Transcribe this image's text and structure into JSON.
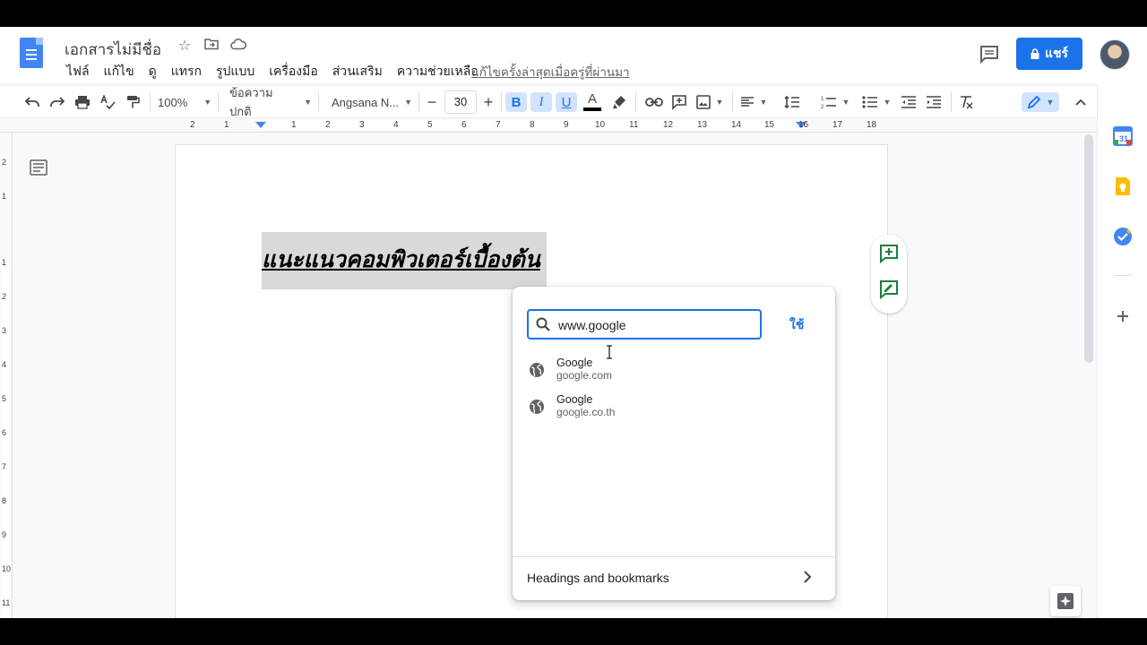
{
  "header": {
    "doc_title": "เอกสารไม่มีชื่อ",
    "menu": [
      "ไฟล์",
      "แก้ไข",
      "ดู",
      "แทรก",
      "รูปแบบ",
      "เครื่องมือ",
      "ส่วนเสริม",
      "ความช่วยเหลือ"
    ],
    "last_edit": "แก้ไขครั้งล่าสุดเมื่อครู่ที่ผ่านมา",
    "share_label": "แชร์"
  },
  "toolbar": {
    "zoom": "100%",
    "style": "ข้อความปกติ",
    "font": "Angsana N...",
    "font_size": "30",
    "bold": "B",
    "italic": "I",
    "underline": "U",
    "text_color": "A",
    "text_color_hex": "#000000"
  },
  "ruler": {
    "numbers": [
      "2",
      "1",
      "1",
      "1",
      "2",
      "3",
      "4",
      "5",
      "6",
      "7",
      "8",
      "9",
      "10",
      "11",
      "12",
      "13",
      "14",
      "15",
      "16",
      "17",
      "18"
    ]
  },
  "vruler": {
    "numbers": [
      "2",
      "1",
      "1",
      "2",
      "3",
      "4",
      "5",
      "6",
      "7",
      "8",
      "9",
      "10",
      "11"
    ]
  },
  "document": {
    "heading": "แนะแนวคอมพิวเตอร์เบื้องต้น"
  },
  "link_popup": {
    "input_value": "www.google",
    "apply_label": "ใช้",
    "suggestions": [
      {
        "title": "Google",
        "url": "google.com"
      },
      {
        "title": "Google",
        "url": "google.co.th"
      }
    ],
    "footer_label": "Headings and bookmarks"
  },
  "colors": {
    "accent": "#1a73e8",
    "selection": "#d9d9d9"
  }
}
